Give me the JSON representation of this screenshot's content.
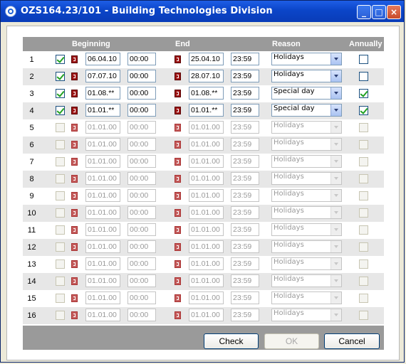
{
  "window": {
    "title": "OZS164.23/101 - Building Technologies Division"
  },
  "header": {
    "beginning": "Beginning",
    "end": "End",
    "reason": "Reason",
    "annually": "Annually"
  },
  "rows": [
    {
      "num": "1",
      "enabled": true,
      "checked": true,
      "begin_date": "06.04.10",
      "begin_time": "00:00",
      "end_date": "25.04.10",
      "end_time": "23:59",
      "reason": "Holidays",
      "annually": false
    },
    {
      "num": "2",
      "enabled": true,
      "checked": true,
      "begin_date": "07.07.10",
      "begin_time": "00:00",
      "end_date": "28.07.10",
      "end_time": "23:59",
      "reason": "Holidays",
      "annually": false
    },
    {
      "num": "3",
      "enabled": true,
      "checked": true,
      "begin_date": "01.08.**",
      "begin_time": "00:00",
      "end_date": "01.08.**",
      "end_time": "23:59",
      "reason": "Special day",
      "annually": true
    },
    {
      "num": "4",
      "enabled": true,
      "checked": true,
      "begin_date": "01.01.**",
      "begin_time": "00:00",
      "end_date": "01.01.**",
      "end_time": "23:59",
      "reason": "Special day",
      "annually": true
    },
    {
      "num": "5",
      "enabled": false,
      "checked": false,
      "begin_date": "01.01.00",
      "begin_time": "00:00",
      "end_date": "01.01.00",
      "end_time": "23:59",
      "reason": "Holidays",
      "annually": false
    },
    {
      "num": "6",
      "enabled": false,
      "checked": false,
      "begin_date": "01.01.00",
      "begin_time": "00:00",
      "end_date": "01.01.00",
      "end_time": "23:59",
      "reason": "Holidays",
      "annually": false
    },
    {
      "num": "7",
      "enabled": false,
      "checked": false,
      "begin_date": "01.01.00",
      "begin_time": "00:00",
      "end_date": "01.01.00",
      "end_time": "23:59",
      "reason": "Holidays",
      "annually": false
    },
    {
      "num": "8",
      "enabled": false,
      "checked": false,
      "begin_date": "01.01.00",
      "begin_time": "00:00",
      "end_date": "01.01.00",
      "end_time": "23:59",
      "reason": "Holidays",
      "annually": false
    },
    {
      "num": "9",
      "enabled": false,
      "checked": false,
      "begin_date": "01.01.00",
      "begin_time": "00:00",
      "end_date": "01.01.00",
      "end_time": "23:59",
      "reason": "Holidays",
      "annually": false
    },
    {
      "num": "10",
      "enabled": false,
      "checked": false,
      "begin_date": "01.01.00",
      "begin_time": "00:00",
      "end_date": "01.01.00",
      "end_time": "23:59",
      "reason": "Holidays",
      "annually": false
    },
    {
      "num": "11",
      "enabled": false,
      "checked": false,
      "begin_date": "01.01.00",
      "begin_time": "00:00",
      "end_date": "01.01.00",
      "end_time": "23:59",
      "reason": "Holidays",
      "annually": false
    },
    {
      "num": "12",
      "enabled": false,
      "checked": false,
      "begin_date": "01.01.00",
      "begin_time": "00:00",
      "end_date": "01.01.00",
      "end_time": "23:59",
      "reason": "Holidays",
      "annually": false
    },
    {
      "num": "13",
      "enabled": false,
      "checked": false,
      "begin_date": "01.01.00",
      "begin_time": "00:00",
      "end_date": "01.01.00",
      "end_time": "23:59",
      "reason": "Holidays",
      "annually": false
    },
    {
      "num": "14",
      "enabled": false,
      "checked": false,
      "begin_date": "01.01.00",
      "begin_time": "00:00",
      "end_date": "01.01.00",
      "end_time": "23:59",
      "reason": "Holidays",
      "annually": false
    },
    {
      "num": "15",
      "enabled": false,
      "checked": false,
      "begin_date": "01.01.00",
      "begin_time": "00:00",
      "end_date": "01.01.00",
      "end_time": "23:59",
      "reason": "Holidays",
      "annually": false
    },
    {
      "num": "16",
      "enabled": false,
      "checked": false,
      "begin_date": "01.01.00",
      "begin_time": "00:00",
      "end_date": "01.01.00",
      "end_time": "23:59",
      "reason": "Holidays",
      "annually": false
    }
  ],
  "buttons": {
    "check": "Check",
    "ok": "OK",
    "cancel": "Cancel"
  },
  "icons": {
    "app": "ie-icon",
    "calendar": "calendar-icon",
    "dropdown": "chevron-down-icon"
  },
  "colors": {
    "titlebar": "#0b45c8",
    "header": "#9a9a9a",
    "check_mark": "#21a121",
    "calendar": "#9d1616"
  }
}
